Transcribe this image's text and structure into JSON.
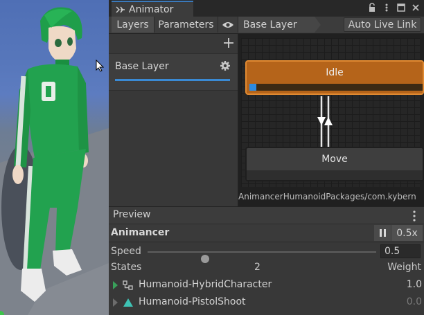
{
  "window": {
    "title": "Animator"
  },
  "toolbar": {
    "tab_layers": "Layers",
    "tab_parameters": "Parameters",
    "breadcrumb": "Base Layer",
    "auto_live_link": "Auto Live Link"
  },
  "layers": {
    "items": [
      {
        "name": "Base Layer"
      }
    ]
  },
  "graph": {
    "nodes": {
      "idle": "Idle",
      "move": "Move"
    },
    "idle_progress": 0.04,
    "path": "AnimancerHumanoidPackages/com.kybern"
  },
  "preview": {
    "title": "Preview",
    "animancer_label": "Animancer",
    "speed_button": "0.5x",
    "speed_label": "Speed",
    "speed_value": "0.5",
    "speed_slider_level": 0.25,
    "states_label": "States",
    "states_count": "2",
    "weight_label": "Weight",
    "states": [
      {
        "name": "Humanoid-HybridCharacter",
        "weight": "1.0",
        "active": true,
        "icon": "blend-tree-icon"
      },
      {
        "name": "Humanoid-PistolShoot",
        "weight": "0.0",
        "active": false,
        "icon": "animation-clip-icon"
      }
    ]
  },
  "colors": {
    "accent": "#3a8ad4",
    "idle_node": "#b5641a",
    "active_state": "#39a05a"
  }
}
